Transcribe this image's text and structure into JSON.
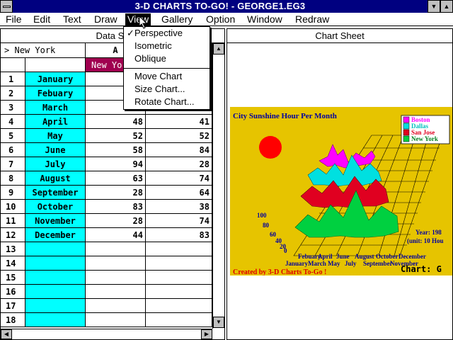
{
  "window": {
    "title": "3-D CHARTS TO-GO! - GEORGE1.EG3",
    "minimize_glyph": "▼",
    "maximize_glyph": "▲"
  },
  "menu": {
    "items": [
      "File",
      "Edit",
      "Text",
      "Draw",
      "View",
      "Gallery",
      "Option",
      "Window",
      "Redraw"
    ],
    "active": "View"
  },
  "view_menu": {
    "items": [
      {
        "label": "Perspective",
        "checked": true
      },
      {
        "label": "Isometric",
        "checked": false
      },
      {
        "label": "Oblique",
        "checked": false
      },
      {
        "label": "Move Chart",
        "checked": false
      },
      {
        "label": "Size Chart...",
        "checked": false
      },
      {
        "label": "Rotate Chart...",
        "checked": false
      }
    ],
    "check_glyph": "✓"
  },
  "data_sheet": {
    "title": "Data Sh",
    "name_box": "New York",
    "name_marker": ">",
    "column_headers": [
      "A",
      ""
    ],
    "series_header": "New Yo",
    "rows": [
      {
        "num": "1",
        "cat": "January",
        "a": "",
        "b": ""
      },
      {
        "num": "2",
        "cat": "Febuary",
        "a": "",
        "b": ""
      },
      {
        "num": "3",
        "cat": "March",
        "a": "",
        "b": ""
      },
      {
        "num": "4",
        "cat": "April",
        "a": "48",
        "b": "41"
      },
      {
        "num": "5",
        "cat": "May",
        "a": "52",
        "b": "52"
      },
      {
        "num": "6",
        "cat": "June",
        "a": "58",
        "b": "84"
      },
      {
        "num": "7",
        "cat": "July",
        "a": "94",
        "b": "28"
      },
      {
        "num": "8",
        "cat": "August",
        "a": "63",
        "b": "74"
      },
      {
        "num": "9",
        "cat": "September",
        "a": "28",
        "b": "64"
      },
      {
        "num": "10",
        "cat": "October",
        "a": "83",
        "b": "38"
      },
      {
        "num": "11",
        "cat": "November",
        "a": "28",
        "b": "74"
      },
      {
        "num": "12",
        "cat": "December",
        "a": "44",
        "b": "83"
      },
      {
        "num": "13",
        "cat": "",
        "a": "",
        "b": ""
      },
      {
        "num": "14",
        "cat": "",
        "a": "",
        "b": ""
      },
      {
        "num": "15",
        "cat": "",
        "a": "",
        "b": ""
      },
      {
        "num": "16",
        "cat": "",
        "a": "",
        "b": ""
      },
      {
        "num": "17",
        "cat": "",
        "a": "",
        "b": ""
      },
      {
        "num": "18",
        "cat": "",
        "a": "",
        "b": ""
      }
    ]
  },
  "chart_sheet": {
    "title": "Chart Sheet",
    "footer": "Chart: G",
    "colors": {
      "background": "#f0d000",
      "boston": "#ff00ff",
      "dallas": "#00e0e0",
      "san_jose": "#e00020",
      "new_york": "#00d040",
      "title_text": "#0000a0",
      "credit_text": "#e00000",
      "sun": "#ff0000"
    }
  },
  "chart_data": {
    "type": "area",
    "title": "City Sunshine Hour Per Month",
    "subtitle": "Year: 198",
    "unit_label": "(unit: 10 Hou",
    "credit": "Created by 3-D Charts To-Go !",
    "legend": [
      "Boston",
      "Dallas",
      "San Jose",
      "New York"
    ],
    "z_ticks": [
      "100",
      "80",
      "60",
      "40",
      "20",
      "0"
    ],
    "x_tick_rows": [
      [
        "Febuary",
        "April",
        "June",
        "August",
        "October",
        "December"
      ],
      [
        "January",
        "March",
        "May",
        "July",
        "September",
        "November"
      ]
    ]
  }
}
